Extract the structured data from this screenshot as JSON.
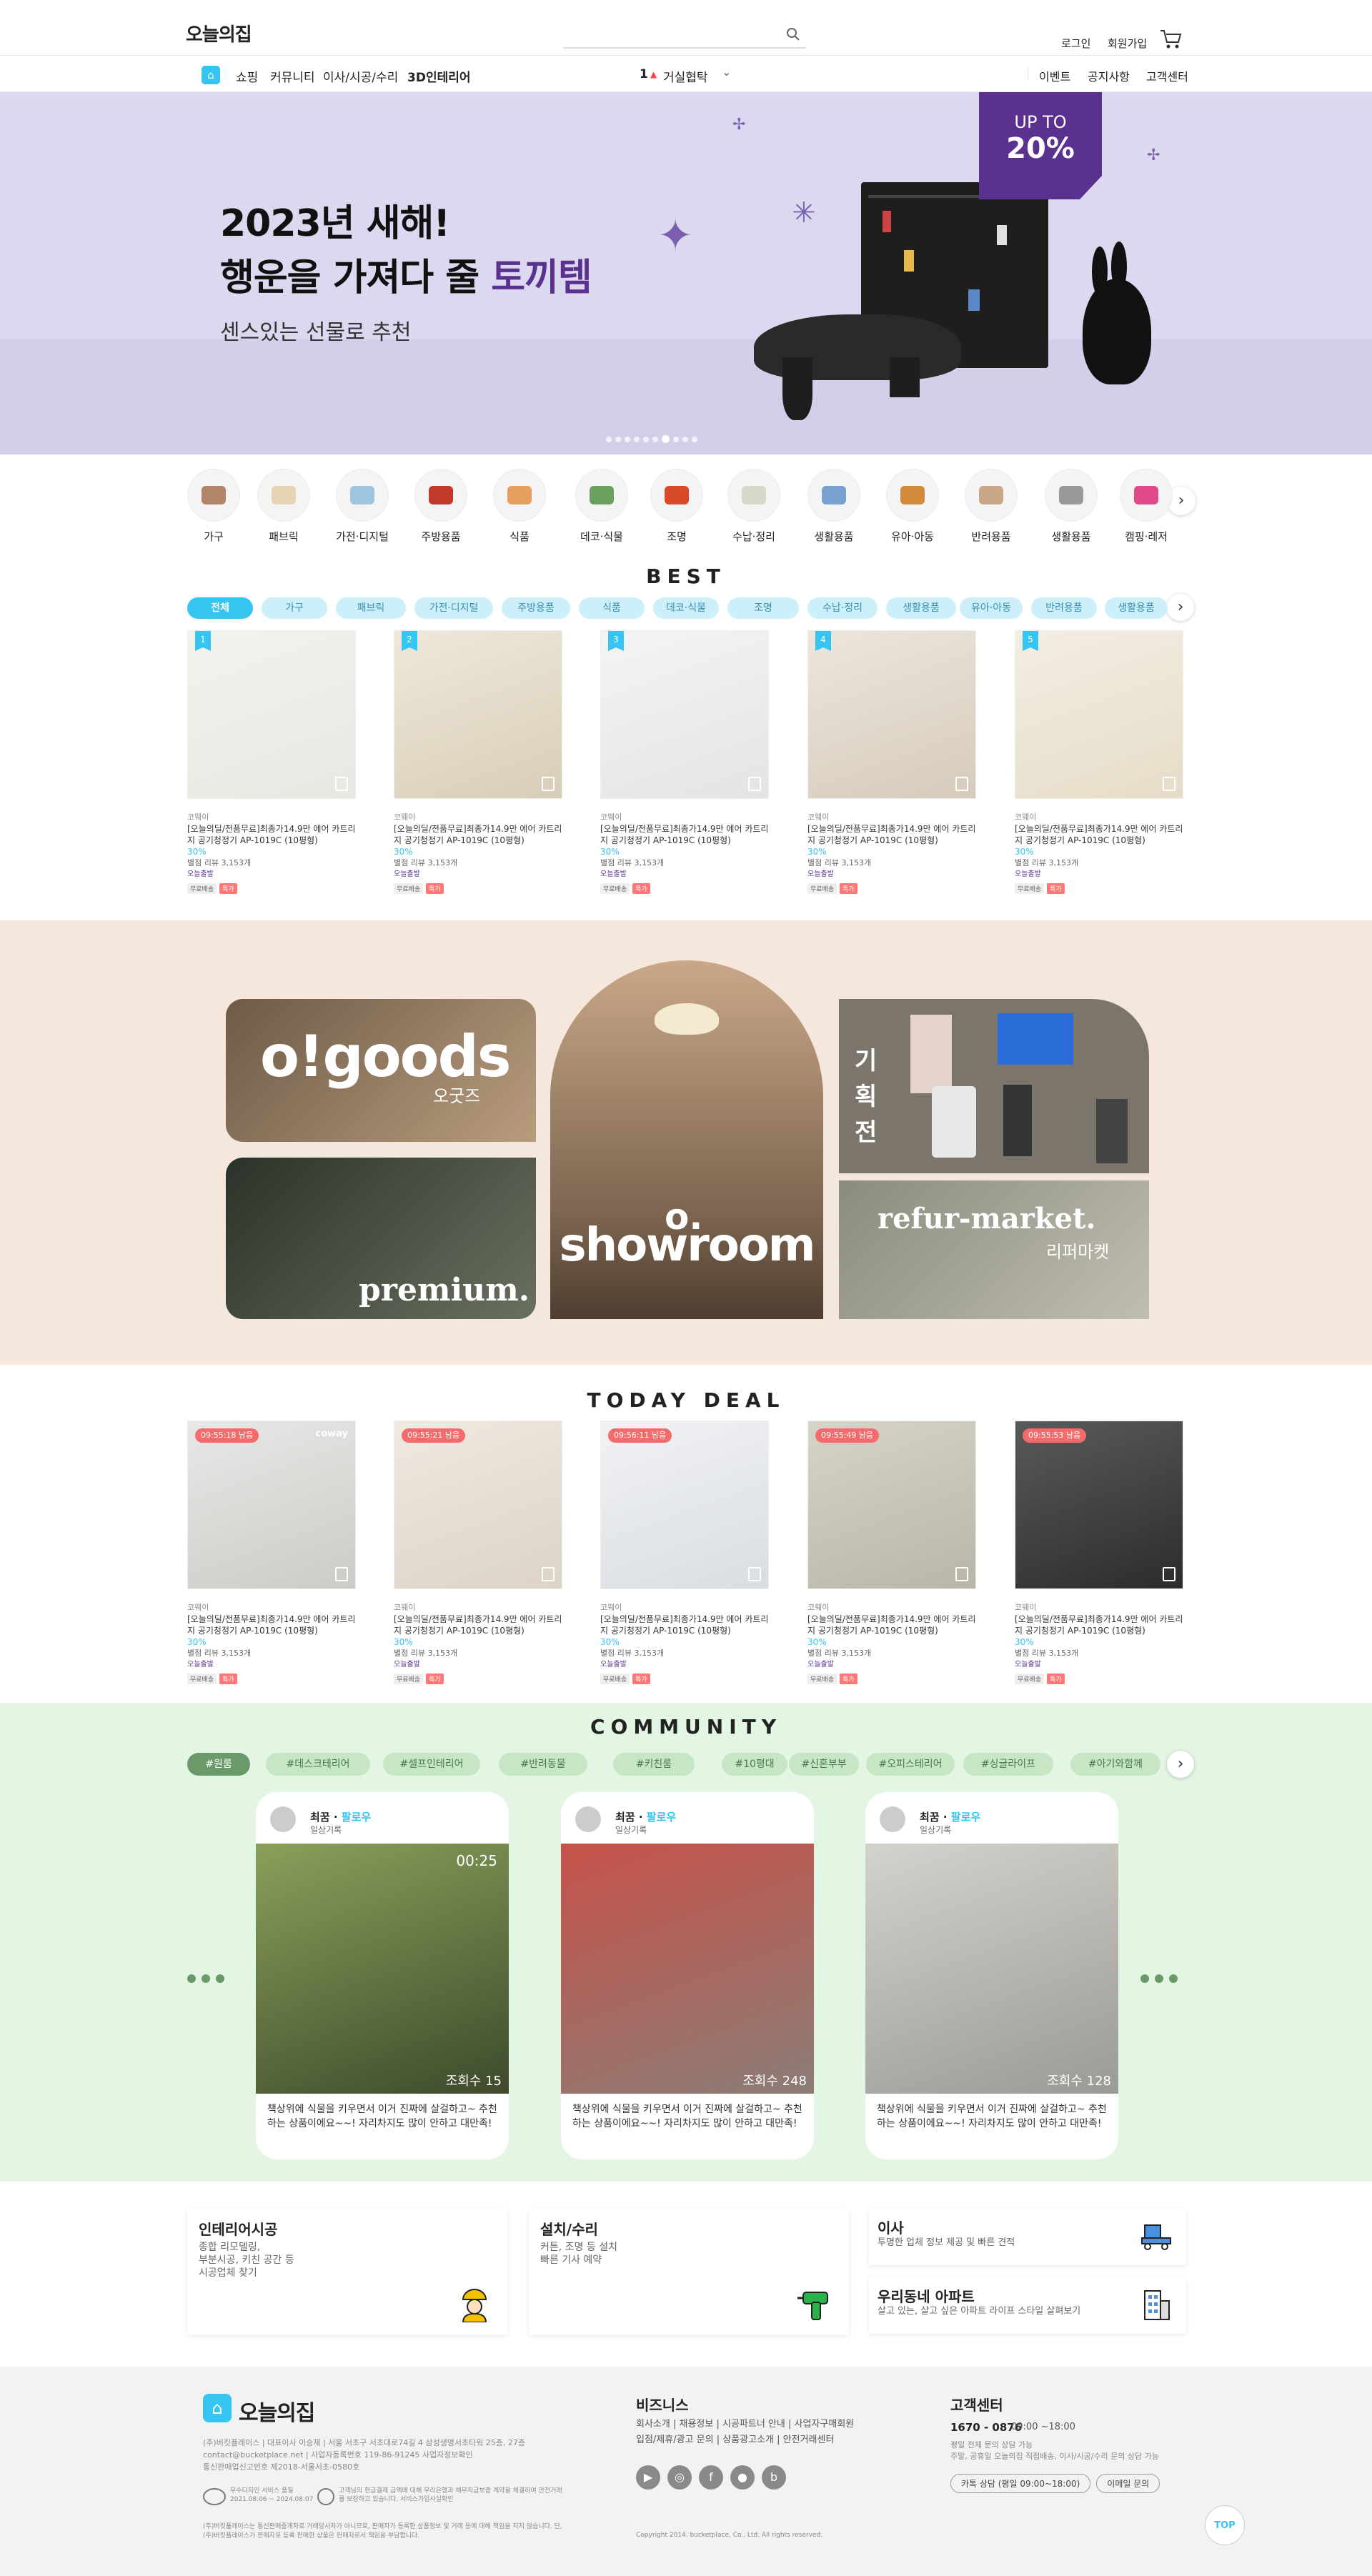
{
  "header": {
    "logo": "오늘의집",
    "search_icon": "search-icon",
    "login": "로그인",
    "signup": "회원가입",
    "cart_icon": "cart-icon"
  },
  "nav": {
    "home_icon": "home-icon",
    "menus": [
      "쇼핑",
      "커뮤니티",
      "이사/시공/수리",
      "3D인테리어"
    ],
    "trend_rank": "1",
    "trend_text": "거실협탁",
    "right": [
      "이벤트",
      "공지사항",
      "고객센터"
    ]
  },
  "hero": {
    "line1": "2023년 새해!",
    "line2_a": "행운을 가져다 줄 ",
    "line2_b": "토끼템",
    "sub": "센스있는 선물로 추천",
    "badge_top": "UP TO",
    "badge_val": "20%",
    "dots": 10,
    "active_dot": 6,
    "accent": "#5b3190"
  },
  "categories": [
    "가구",
    "패브릭",
    "가전·디지털",
    "주방용품",
    "식품",
    "데코·식물",
    "조명",
    "수납·정리",
    "생활용품",
    "유아·아동",
    "반려용품",
    "생활용품",
    "캠핑·레저"
  ],
  "best": {
    "title": "BEST",
    "chips": [
      "전체",
      "가구",
      "패브릭",
      "가전·디지털",
      "주방용품",
      "식품",
      "데코·식물",
      "조명",
      "수납·정리",
      "생활용품",
      "유아·아동",
      "반려용품",
      "생활용품"
    ],
    "products": [
      {
        "rank": "1",
        "brand": "코웨이",
        "name": "[오늘의딜/전품무료]최종가14.9만 에어 카트리지 공기청정기 AP-1019C (10평형)",
        "pct": "30%",
        "rating": "별점 리뷰 3,153개",
        "badge": "오늘출발",
        "tag1": "무료배송",
        "tag2": "특가",
        "colors": [
          "#e9e7e2",
          "#f4f2ec"
        ]
      },
      {
        "rank": "2",
        "brand": "코웨이",
        "name": "[오늘의딜/전품무료]최종가14.9만 에어 카트리지 공기청정기 AP-1019C (10평형)",
        "pct": "30%",
        "rating": "별점 리뷰 3,153개",
        "badge": "오늘출발",
        "tag1": "무료배송",
        "tag2": "특가",
        "colors": [
          "#d8cdb8",
          "#efe8da"
        ]
      },
      {
        "rank": "3",
        "brand": "코웨이",
        "name": "[오늘의딜/전품무료]최종가14.9만 에어 카트리지 공기청정기 AP-1019C (10평형)",
        "pct": "30%",
        "rating": "별점 리뷰 3,153개",
        "badge": "오늘출발",
        "tag1": "무료배송",
        "tag2": "특가",
        "colors": [
          "#e4e4e4",
          "#f4f4f4"
        ]
      },
      {
        "rank": "4",
        "brand": "코웨이",
        "name": "[오늘의딜/전품무료]최종가14.9만 에어 카트리지 공기청정기 AP-1019C (10평형)",
        "pct": "30%",
        "rating": "별점 리뷰 3,153개",
        "badge": "오늘출발",
        "tag1": "무료배송",
        "tag2": "특가",
        "colors": [
          "#d6cbbb",
          "#ece6dc"
        ]
      },
      {
        "rank": "5",
        "brand": "코웨이",
        "name": "[오늘의딜/전품무료]최종가14.9만 에어 카트리지 공기청정기 AP-1019C (10평형)",
        "pct": "30%",
        "rating": "별점 리뷰 3,153개",
        "badge": "오늘출발",
        "tag1": "무료배송",
        "tag2": "특가",
        "colors": [
          "#e6dcc8",
          "#f3eee3"
        ]
      }
    ]
  },
  "promo": {
    "ogoods": "o!goods",
    "ogoods_sub": "오굿즈",
    "premium": "premium.",
    "showroom": "showroom",
    "plan": [
      "기",
      "획",
      "전"
    ],
    "refur": "refur-market.",
    "refur_sub": "리퍼마켓"
  },
  "deal": {
    "title": "TODAY DEAL",
    "products": [
      {
        "timer": "09:55:18 남음",
        "brand": "코웨이",
        "name": "[오늘의딜/전품무료]최종가14.9만 에어 카트리지 공기청정기 AP-1019C (10평형)",
        "pct": "30%",
        "rating": "별점 리뷰 3,153개",
        "badge": "오늘출발",
        "tag1": "무료배송",
        "tag2": "특가",
        "colors": [
          "#c9ccc7",
          "#e8e8e6"
        ],
        "mark": "coway"
      },
      {
        "timer": "09:55:21 남음",
        "brand": "코웨이",
        "name": "[오늘의딜/전품무료]최종가14.9만 에어 카트리지 공기청정기 AP-1019C (10평형)",
        "pct": "30%",
        "rating": "별점 리뷰 3,153개",
        "badge": "오늘출발",
        "tag1": "무료배송",
        "tag2": "특가",
        "colors": [
          "#ddd3c6",
          "#efe9e1"
        ],
        "mark": ""
      },
      {
        "timer": "09:56:11 남음",
        "brand": "코웨이",
        "name": "[오늘의딜/전품무료]최종가14.9만 에어 카트리지 공기청정기 AP-1019C (10평형)",
        "pct": "30%",
        "rating": "별점 리뷰 3,153개",
        "badge": "오늘출발",
        "tag1": "무료배송",
        "tag2": "특가",
        "colors": [
          "#d9dde2",
          "#f1f2f4"
        ],
        "mark": ""
      },
      {
        "timer": "09:55:49 남음",
        "brand": "코웨이",
        "name": "[오늘의딜/전품무료]최종가14.9만 에어 카트리지 공기청정기 AP-1019C (10평형)",
        "pct": "30%",
        "rating": "별점 리뷰 3,153개",
        "badge": "오늘출발",
        "tag1": "무료배송",
        "tag2": "특가",
        "colors": [
          "#b9b5a8",
          "#d7d3c8"
        ],
        "mark": ""
      },
      {
        "timer": "09:55:53 남음",
        "brand": "코웨이",
        "name": "[오늘의딜/전품무료]최종가14.9만 에어 카트리지 공기청정기 AP-1019C (10평형)",
        "pct": "30%",
        "rating": "별점 리뷰 3,153개",
        "badge": "오늘출발",
        "tag1": "무료배송",
        "tag2": "특가",
        "colors": [
          "#2c2c2c",
          "#5a5a5a"
        ],
        "mark": ""
      }
    ]
  },
  "community": {
    "title": "COMMUNITY",
    "chips": [
      "#원룸",
      "#데스크테리어",
      "#셀프인테리어",
      "#반려동물",
      "#키친룸",
      "#10평대",
      "#신혼부부",
      "#오피스테리어",
      "#싱글라이프",
      "#아기와함께"
    ],
    "posts": [
      {
        "user": "최꿈",
        "follow": "팔로우",
        "sub": "일상기록",
        "duration": "00:25",
        "views": "조회수 15",
        "text": "책상위에 식물을 키우면서 이거 진짜에 살걸하고~ 추천하는 상품이에요~~! 자리차지도 많이 안하고 대만족!",
        "colors": [
          "#3e4a2c",
          "#8aa05a"
        ]
      },
      {
        "user": "최꿈",
        "follow": "팔로우",
        "sub": "일상기록",
        "duration": "",
        "views": "조회수 248",
        "text": "책상위에 식물을 키우면서 이거 진짜에 살걸하고~ 추천하는 상품이에요~~! 자리차지도 많이 안하고 대만족!",
        "colors": [
          "#8a7d76",
          "#c7524a"
        ]
      },
      {
        "user": "최꿈",
        "follow": "팔로우",
        "sub": "일상기록",
        "duration": "",
        "views": "조회수 128",
        "text": "책상위에 식물을 키우면서 이거 진짜에 살걸하고~ 추천하는 상품이에요~~! 자리차지도 많이 안하고 대만족!",
        "colors": [
          "#9a9a96",
          "#d4d2cc"
        ]
      }
    ]
  },
  "services": [
    {
      "title": "인테리어시공",
      "desc": "종합 리모델링,\n부분시공, 키친 공간 등\n시공업체 찾기",
      "icon": "worker-icon"
    },
    {
      "title": "설치/수리",
      "desc": "커튼, 조명 등 설치\n빠른 기사 예약",
      "icon": "drill-icon"
    },
    {
      "title": "이사",
      "desc": "투명한 업체 정보 제공 및 빠른 견적",
      "icon": "truck-icon"
    },
    {
      "title": "우리동네 아파트",
      "desc": "살고 있는, 살고 싶은 아파트 라이프 스타일 살펴보기",
      "icon": "building-icon"
    }
  ],
  "footer": {
    "logo": "오늘의집",
    "company": [
      "(주)버킷플레이스 | 대표이사 이승재 | 서울 서초구 서초대로74길 4 삼성생명서초타워 25층, 27층",
      "contact@bucketplace.net | 사업자등록번호 119-86-91245 사업자정보확인",
      "통신판매업신고번호 제2018-서울서초-0580호"
    ],
    "cert1": "우수디자인 서비스 품질 2021.08.06 ~ 2024.08.07",
    "cert2": "고객님의 현금결제 금액에 대해 우리은행과 채무지급보증 계약을 체결하여 안전거래를 보장하고 있습니다. 서비스가입사실확인",
    "notice": "(주)버킷플레이스는 통신판매중개자로 거래당사자가 아니므로, 판매자가 등록한 상품정보 및 거래 등에 대해 책임을 지지 않습니다. 단, (주)버킷플레이스가 판매자로 등록 판매한 상품은 판매자로서 책임을 부담합니다.",
    "biz_title": "비즈니스",
    "biz_links": [
      "회사소개",
      "채용정보",
      "시공파트너 안내",
      "사업자구매회원",
      "입점/제휴/광고 문의",
      "상품광고소개",
      "안전거래센터"
    ],
    "sns": [
      "youtube-icon",
      "instagram-icon",
      "facebook-icon",
      "kakao-icon",
      "naverblog-icon"
    ],
    "copyright": "Copyright 2014. bucketplace, Co., Ltd. All rights reserved.",
    "cs_title": "고객센터",
    "cs_phone": "1670 - 0876",
    "cs_hours": "09:00 ~18:00",
    "cs_l1": "평일 전체 문의 상담 가능",
    "cs_l2": "주말, 공휴일 오늘의집 직접배송, 이사/시공/수리 문의 상담 가능",
    "cs_btn1": "카톡 상담 (평일 09:00~18:00)",
    "cs_btn2": "이메일 문의",
    "top": "TOP"
  }
}
